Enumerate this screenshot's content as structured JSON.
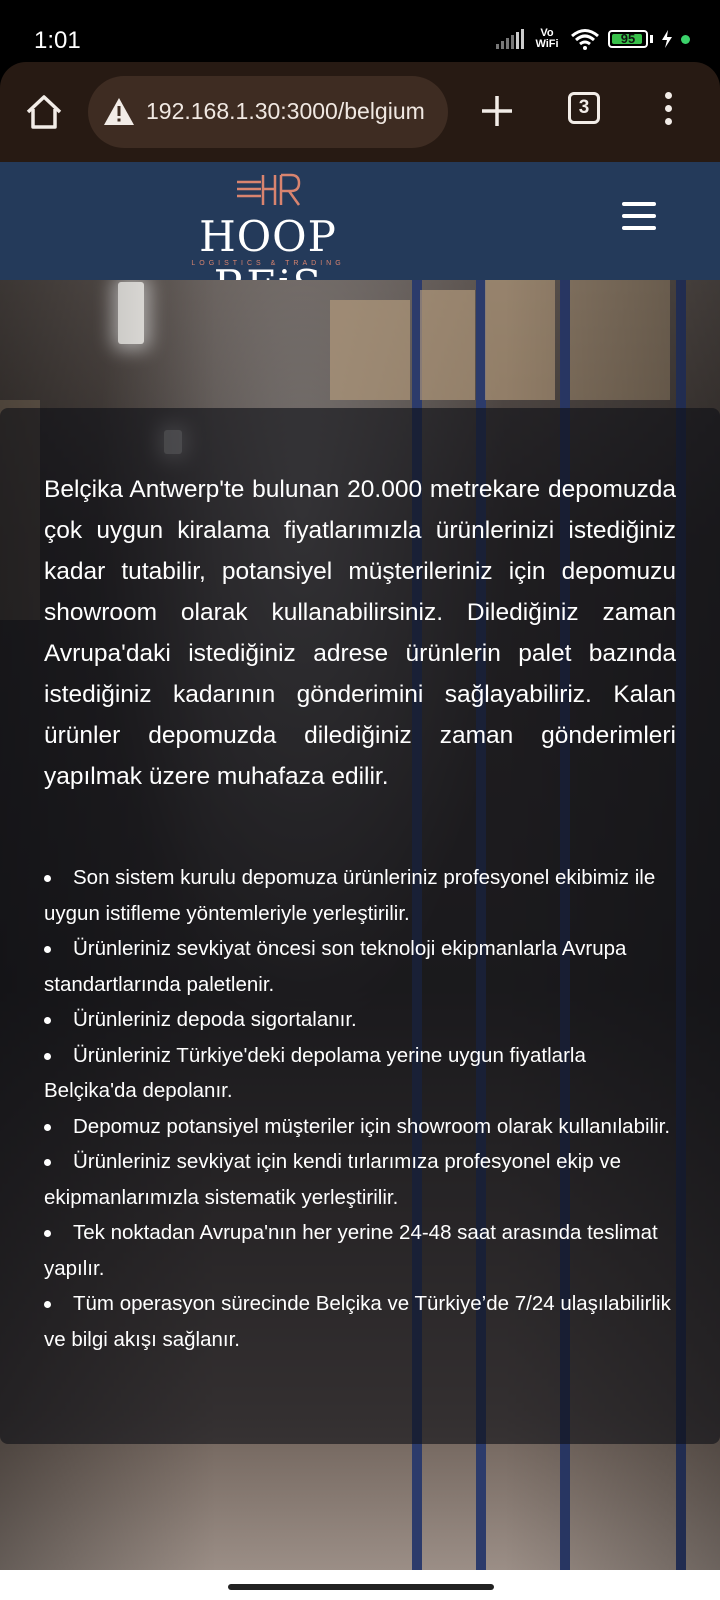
{
  "status_bar": {
    "time": "1:01",
    "network_label": "Vo WiFi",
    "battery_percent": "95",
    "battery_level": 0.95,
    "icons": [
      "signal-icon",
      "wifi-icon",
      "battery-icon",
      "charging-icon",
      "dot-icon"
    ]
  },
  "browser": {
    "url": "192.168.1.30:3000/belgium",
    "tab_count": "3",
    "icons": [
      "home-icon",
      "warning-icon",
      "plus-icon",
      "tabs-icon",
      "more-vertical-icon"
    ]
  },
  "site": {
    "logo_name": "HOOP REiS",
    "logo_tagline": "LOGISTICS & TRADING",
    "logo_monogram": "HR",
    "menu_icon": "hamburger-icon"
  },
  "content": {
    "intro": "Belçika Antwerp'te bulunan 20.000 metrekare depomuzda çok uygun kiralama fiyatlarımızla ürünlerinizi istediğiniz kadar tutabilir, potansiyel müşterileriniz için depomuzu showroom olarak kullanabilirsiniz. Dilediğiniz zaman Avrupa'daki istediğiniz adrese ürünlerin palet bazında istediğiniz kadarının gönderimini sağlayabiliriz. Kalan ürünler depomuzda dilediğiniz zaman gönderimleri yapılmak üzere muhafaza edilir.",
    "features": [
      "Son sistem kurulu depomuza ürünleriniz profesyonel ekibimiz ile uygun istifleme yöntemleriyle yerleştirilir.",
      "Ürünleriniz sevkiyat öncesi son teknoloji ekipmanlarla Avrupa standartlarında paletlenir.",
      "Ürünleriniz depoda sigortalanır.",
      "Ürünleriniz Türkiye'deki depolama yerine uygun fiyatlarla Belçika'da depolanır.",
      "Depomuz potansiyel müşteriler için showroom olarak kullanılabilir.",
      "Ürünleriniz sevkiyat için kendi tırlarımıza profesyonel ekip ve ekipmanlarımızla sistematik yerleştirilir.",
      "Tek noktadan Avrupa'nın her yerine 24-48 saat arasında teslimat yapılır.",
      "Tüm operasyon sürecinde Belçika ve Türkiye’de 7/24 ulaşılabilirlik ve bilgi akışı sağlanır."
    ]
  },
  "colors": {
    "header_bg": "#243a5a",
    "browser_bg": "#271a13",
    "logo_accent": "#d9846f",
    "battery_green": "#38c04a"
  }
}
